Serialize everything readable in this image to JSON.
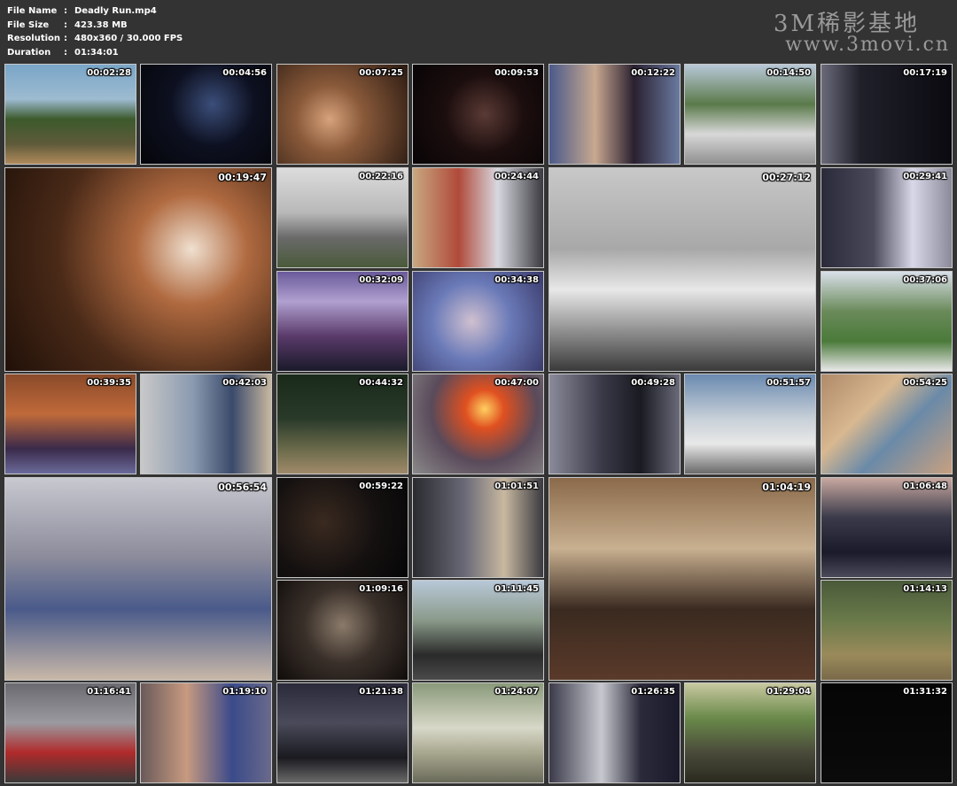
{
  "info": {
    "labels": {
      "name": "File Name",
      "size": "File Size",
      "res": "Resolution",
      "dur": "Duration"
    },
    "sep": ":",
    "file_name": "Deadly Run.mp4",
    "file_size": "423.38 MB",
    "resolution": "480x360 / 30.000 FPS",
    "duration": "01:34:01"
  },
  "watermark": {
    "line1": "3M稀影基地",
    "line2": "www.3movi.cn"
  },
  "thumbs": [
    {
      "ts": "00:02:28",
      "bg": "linear-gradient(180deg,#7aa6c8 0%,#9dbbd0 35%,#3c5a2c 55%,#5e5a3a 80%,#b08a5a 100%)"
    },
    {
      "ts": "00:04:56",
      "bg": "radial-gradient(circle at 55% 40%,#3b4e7a 0%,#0d1020 45%,#05060a 100%)"
    },
    {
      "ts": "00:07:25",
      "bg": "radial-gradient(circle at 40% 55%,#d7a27c 0%,#8a5a3a 35%,#2a1a12 100%)"
    },
    {
      "ts": "00:09:53",
      "bg": "radial-gradient(circle at 55% 50%,#5a3a35 0%,#1c0e0e 45%,#080406 100%)"
    },
    {
      "ts": "00:12:22",
      "bg": "linear-gradient(90deg,#4a5a8a 0%,#c8a890 35%,#2a2030 65%,#6a7aa0 100%)"
    },
    {
      "ts": "00:14:50",
      "bg": "linear-gradient(180deg,#b8c8d8 0%,#5a7a4a 40%,#d8d8d8 70%,#909090 100%)"
    },
    {
      "ts": "00:17:19",
      "bg": "linear-gradient(90deg,#6a6a7a 0%,#20202a 30%,#0a0a10 100%)"
    },
    {
      "ts": "00:19:47",
      "bg": "radial-gradient(circle at 70% 40%,#f0e0d0 0%,#b06a40 25%,#4a2a18 60%,#201008 100%)"
    },
    {
      "ts": "00:22:16",
      "bg": "linear-gradient(180deg,#dcdcdc 0%,#b8b8b8 45%,#6a6a6a 70%,#4a5a3a 100%)"
    },
    {
      "ts": "00:24:44",
      "bg": "linear-gradient(90deg,#c8a880 0%,#b04a3a 35%,#d8d8e0 65%,#3a3a40 100%)"
    },
    {
      "ts": "00:27:12",
      "bg": "linear-gradient(180deg,#c8c8c8 0%,#a8a8a8 40%,#e8e8e8 60%,#3a3a3a 100%)"
    },
    {
      "ts": "00:29:41",
      "bg": "linear-gradient(90deg,#2a2a3a 0%,#4a4a5a 40%,#d8d8e8 70%,#8a8a9a 100%)"
    },
    {
      "ts": "00:32:09",
      "bg": "linear-gradient(180deg,#6a5a9a 0%,#b0a0d0 30%,#5a3a6a 65%,#1a1a2a 100%)"
    },
    {
      "ts": "00:34:38",
      "bg": "radial-gradient(circle at 45% 50%,#d0c0d0 0%,#6a7ab8 45%,#3a3a6a 100%)"
    },
    {
      "ts": "00:37:06",
      "bg": "linear-gradient(180deg,#d8dfe8 0%,#6a8a5a 40%,#4a7a3a 70%,#e8e8e8 100%)"
    },
    {
      "ts": "00:39:35",
      "bg": "linear-gradient(180deg,#8a4a2a 0%,#c06a3a 40%,#3a2a4a 75%,#6a6a9a 100%)"
    },
    {
      "ts": "00:42:03",
      "bg": "linear-gradient(90deg,#c8c8c8 0%,#8a9ab0 40%,#3a4a6a 70%,#c8b8a0 100%)"
    },
    {
      "ts": "00:44:32",
      "bg": "linear-gradient(180deg,#1a2a1a 0%,#2a3a2a 45%,#6a6a4a 75%,#a08a6a 100%)"
    },
    {
      "ts": "00:47:00",
      "bg": "radial-gradient(circle at 55% 35%,#ffd060 0%,#e05020 20%,#5a4a5a 55%,#8a8a8a 100%)"
    },
    {
      "ts": "00:49:28",
      "bg": "linear-gradient(90deg,#8a8a9a 0%,#3a3a48 40%,#1a1a22 70%,#6a6a7a 100%)"
    },
    {
      "ts": "00:51:57",
      "bg": "linear-gradient(180deg,#6a8ab0 0%,#c8d0d8 45%,#e8e8e8 70%,#6a6a6a 100%)"
    },
    {
      "ts": "00:54:25",
      "bg": "linear-gradient(135deg,#b08a6a 0%,#d8b890 35%,#6a8aa8 60%,#c8a080 100%)"
    },
    {
      "ts": "00:56:54",
      "bg": "linear-gradient(180deg,#c8c8d0 0%,#8a8a9a 40%,#4a5a8a 65%,#c8b8a8 100%)"
    },
    {
      "ts": "00:59:22",
      "bg": "radial-gradient(circle at 35% 45%,#3a2a20 0%,#141010 55%,#060606 100%)"
    },
    {
      "ts": "01:01:51",
      "bg": "linear-gradient(90deg,#2a2a30 0%,#6a6a78 40%,#c8b8a0 70%,#3a3a40 100%)"
    },
    {
      "ts": "01:04:19",
      "bg": "linear-gradient(180deg,#8a6a4a 0%,#c8b090 35%,#3a2a20 65%,#5a3a2a 100%)"
    },
    {
      "ts": "01:06:48",
      "bg": "linear-gradient(180deg,#c8a8a0 0%,#3a3a4a 40%,#1a1a2a 75%,#4a4a5a 100%)"
    },
    {
      "ts": "01:09:16",
      "bg": "radial-gradient(circle at 50% 45%,#8a7a6a 0%,#3a302a 45%,#100c0a 100%)"
    },
    {
      "ts": "01:11:45",
      "bg": "linear-gradient(180deg,#b8c8d8 0%,#8a9a8a 40%,#2a2a2a 75%,#4a4a4a 100%)"
    },
    {
      "ts": "01:14:13",
      "bg": "linear-gradient(180deg,#4a5a3a 0%,#6a7a4a 40%,#9a8a5a 75%,#7a6a4a 100%)"
    },
    {
      "ts": "01:16:41",
      "bg": "linear-gradient(180deg,#6a6a70 0%,#9a9aa0 40%,#b02a2a 70%,#3a3a3a 100%)"
    },
    {
      "ts": "01:19:10",
      "bg": "linear-gradient(90deg,#6a5a5a 0%,#c89a80 35%,#3a4a8a 70%,#6a6a8a 100%)"
    },
    {
      "ts": "01:21:38",
      "bg": "linear-gradient(180deg,#2a2a3a 0%,#4a4a5a 40%,#1a1a20 75%,#6a6a6a 100%)"
    },
    {
      "ts": "01:24:07",
      "bg": "linear-gradient(180deg,#8a9a7a 0%,#d8d8c8 45%,#a8a890 70%,#6a6a5a 100%)"
    },
    {
      "ts": "01:26:35",
      "bg": "linear-gradient(90deg,#3a3a4a 0%,#c8c8d0 40%,#2a2a3a 70%,#1a1a2a 100%)"
    },
    {
      "ts": "01:29:04",
      "bg": "linear-gradient(180deg,#c8c8a0 0%,#6a8a4a 35%,#4a4a3a 70%,#2a2a20 100%)"
    },
    {
      "ts": "01:31:32",
      "bg": "linear-gradient(180deg,#050505 0%,#0a0a0a 100%)"
    }
  ]
}
